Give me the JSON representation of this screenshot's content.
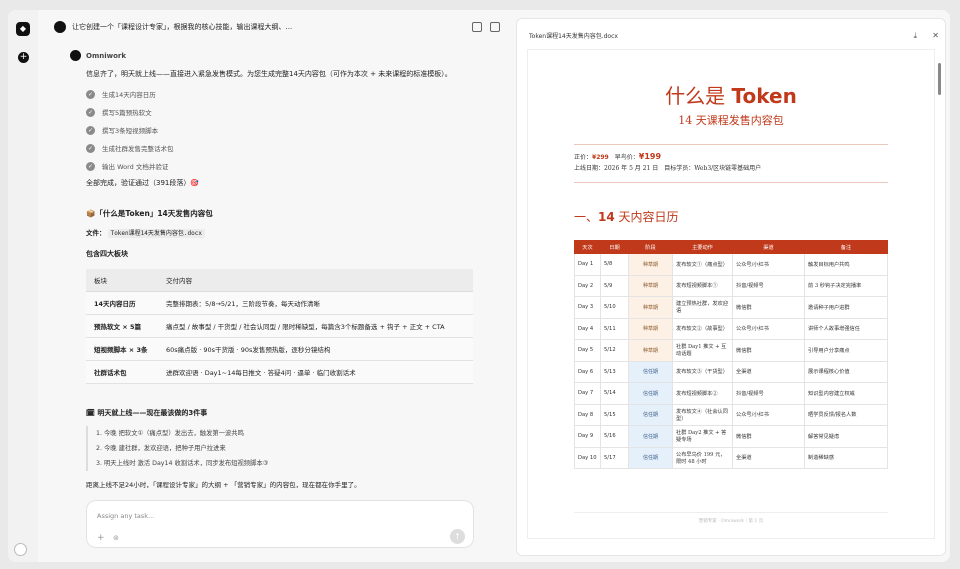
{
  "topbar": {
    "title": "让它创建一个「课程设计专家」，根据我的核心技能，输出课程大纲、..."
  },
  "message": {
    "author": "Omniwork",
    "intro": "信息齐了，明天就上线——直接进入紧急发售模式。为您生成完整14天内容包（可作为本次 + 未来课程的标准模板）。",
    "steps": [
      "生成14天内容日历",
      "撰写5篇预热软文",
      "撰写3条短视频脚本",
      "生成社群发售完整话术包",
      "输出 Word 文档并验证"
    ],
    "done": "全部完成，验证通过（391段落）🎯",
    "heading": "📦「什么是Token」14天发售内容包",
    "file_label": "文件：",
    "file_name": "Token课程14天发售内容包.docx",
    "blocks_heading": "包含四大板块",
    "table_headers": [
      "板块",
      "交付内容"
    ],
    "table_rows": [
      [
        "14天内容日历",
        "完整排期表：5/8→5/21，三阶段节奏，每天动作清晰"
      ],
      [
        "预热软文 × 5篇",
        "痛点型 / 故事型 / 干货型 / 社会认同型 / 限时稀缺型，每篇含3个标题备选 + 钩子 + 正文 + CTA"
      ],
      [
        "短视频脚本 × 3条",
        "60s痛点版 · 90s干货版 · 90s发售预热版，逐秒分镜结构"
      ],
      [
        "社群话术包",
        "进群欢迎语 · Day1~14每日推文 · 答疑4问 · 逼单 · 临门收割话术"
      ]
    ],
    "todo_heading": "🗓 明天就上线——现在最该做的3件事",
    "todo": [
      "1. 今晚 把软文①（痛点型）发出去，触发第一波共鸣",
      "2. 今晚 建社群，发欢迎语，把种子用户拉进来",
      "3. 明天上线时 激活 Day14 收割话术，同步发布短视频脚本③"
    ],
    "closing": "距离上线不足24小时，「课程设计专家」的大纲 + 「营销专家」的内容包，现在都在你手里了。"
  },
  "input": {
    "placeholder": "Assign any task..."
  },
  "doc": {
    "filename": "Token课程14天发售内容包.docx",
    "title_prefix": "什么是",
    "title_main": "Token",
    "subtitle": "14 天课程发售内容包",
    "price_label": "正价：",
    "price": "¥299",
    "early_label": "早鸟价：",
    "early_price": "¥199",
    "launch": "上线日期：2026 年 5 月 21 日　目标学员：Web3/区块链零基础用户",
    "section_num": "一、",
    "section_num2": "14",
    "section_title": "天内容日历",
    "headers": [
      "天次",
      "日期",
      "阶段",
      "主要动作",
      "渠道",
      "备注"
    ],
    "rows": [
      [
        "Day 1",
        "5/8",
        "种草期",
        "发布软文①（痛点型）",
        "公众号/小红书",
        "触发目标用户共鸣"
      ],
      [
        "Day 2",
        "5/9",
        "种草期",
        "发布短视频脚本①",
        "抖音/视频号",
        "前 3 秒钩子决定完播率"
      ],
      [
        "Day 3",
        "5/10",
        "种草期",
        "建立预热社群，发欢迎语",
        "微信群",
        "邀请种子用户进群"
      ],
      [
        "Day 4",
        "5/11",
        "种草期",
        "发布软文②（故事型）",
        "公众号/小红书",
        "讲师个人故事增强信任"
      ],
      [
        "Day 5",
        "5/12",
        "种草期",
        "社群 Day1 推文 + 互动话题",
        "微信群",
        "引导用户分享痛点"
      ],
      [
        "Day 6",
        "5/13",
        "信任期",
        "发布软文③（干货型）",
        "全渠道",
        "展示课程核心价值"
      ],
      [
        "Day 7",
        "5/14",
        "信任期",
        "发布短视频脚本②",
        "抖音/视频号",
        "知识型内容建立权威"
      ],
      [
        "Day 8",
        "5/15",
        "信任期",
        "发布软文④（社会认同型）",
        "公众号/小红书",
        "晒学员反馈/报名人数"
      ],
      [
        "Day 9",
        "5/16",
        "信任期",
        "社群 Day2 推文 + 答疑专场",
        "微信群",
        "解答常见疑虑"
      ],
      [
        "Day 10",
        "5/17",
        "信任期",
        "公布早鸟价 199 元，限时 48 小时",
        "全渠道",
        "制造稀缺感"
      ]
    ],
    "footer": "营销专家 · Omniwork｜第 1 页"
  },
  "colors": {
    "accent": "#c0391b"
  }
}
